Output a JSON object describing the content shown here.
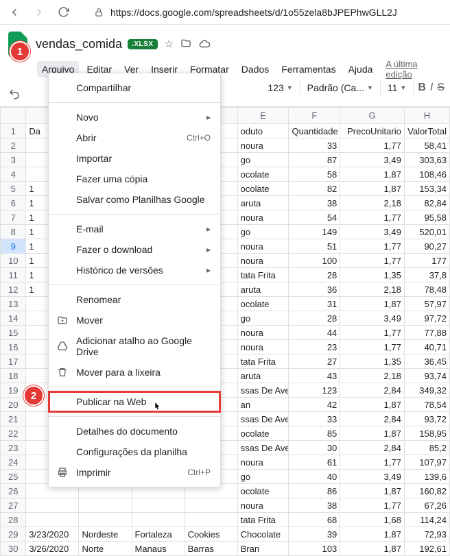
{
  "browser": {
    "url": "https://docs.google.com/spreadsheets/d/1o55zela8bJPEPhwGLL2J"
  },
  "doc": {
    "title": "vendas_comida",
    "badge": ".XLSX"
  },
  "menubar": {
    "items": [
      "Arquivo",
      "Editar",
      "Ver",
      "Inserir",
      "Formatar",
      "Dados",
      "Ferramentas",
      "Ajuda"
    ],
    "last_edit": "A última edição"
  },
  "toolbar": {
    "num_fmt": "123",
    "font": "Padrão (Ca...",
    "font_size": "11",
    "bold": "B",
    "italic": "I",
    "strike": "S"
  },
  "dropdown": {
    "items": [
      {
        "label": "Compartilhar",
        "hasSubmenu": false
      },
      "sep",
      {
        "label": "Novo",
        "hasSubmenu": true
      },
      {
        "label": "Abrir",
        "hasSubmenu": false,
        "shortcut": "Ctrl+O"
      },
      {
        "label": "Importar",
        "hasSubmenu": false
      },
      {
        "label": "Fazer uma cópia",
        "hasSubmenu": false
      },
      {
        "label": "Salvar como Planilhas Google",
        "hasSubmenu": false
      },
      "sep",
      {
        "label": "E-mail",
        "hasSubmenu": true
      },
      {
        "label": "Fazer o download",
        "hasSubmenu": true
      },
      {
        "label": "Histórico de versões",
        "hasSubmenu": true
      },
      "sep",
      {
        "label": "Renomear",
        "hasSubmenu": false
      },
      {
        "label": "Mover",
        "hasSubmenu": false,
        "icon": "folder"
      },
      {
        "label": "Adicionar atalho ao Google Drive",
        "hasSubmenu": false,
        "icon": "drive"
      },
      {
        "label": "Mover para a lixeira",
        "hasSubmenu": false,
        "icon": "trash"
      },
      "sep",
      {
        "label": "Publicar na Web",
        "hasSubmenu": false,
        "highlight": true
      },
      "sep",
      {
        "label": "Detalhes do documento",
        "hasSubmenu": false
      },
      {
        "label": "Configurações da planilha",
        "hasSubmenu": false
      },
      {
        "label": "Imprimir",
        "hasSubmenu": false,
        "shortcut": "Ctrl+P",
        "icon": "print"
      }
    ]
  },
  "columns": [
    "E",
    "F",
    "G",
    "H"
  ],
  "headers": {
    "A": "Da",
    "E": "oduto",
    "F": "Quantidade",
    "G": "PrecoUnitario",
    "H": "ValorTotal"
  },
  "rows": [
    {
      "n": 2,
      "A": "",
      "E": "noura",
      "F": "33",
      "G": "1,77",
      "H": "58,41"
    },
    {
      "n": 3,
      "A": "",
      "E": "go",
      "F": "87",
      "G": "3,49",
      "H": "303,63"
    },
    {
      "n": 4,
      "A": "",
      "E": "ocolate",
      "F": "58",
      "G": "1,87",
      "H": "108,46"
    },
    {
      "n": 5,
      "A": "1",
      "E": "ocolate",
      "F": "82",
      "G": "1,87",
      "H": "153,34"
    },
    {
      "n": 6,
      "A": "1",
      "E": "aruta",
      "F": "38",
      "G": "2,18",
      "H": "82,84"
    },
    {
      "n": 7,
      "A": "1",
      "E": "noura",
      "F": "54",
      "G": "1,77",
      "H": "95,58"
    },
    {
      "n": 8,
      "A": "1",
      "E": "go",
      "F": "149",
      "G": "3,49",
      "H": "520,01"
    },
    {
      "n": 9,
      "A": "1",
      "E": "noura",
      "F": "51",
      "G": "1,77",
      "H": "90,27",
      "sel": true
    },
    {
      "n": 10,
      "A": "1",
      "E": "noura",
      "F": "100",
      "G": "1,77",
      "H": "177"
    },
    {
      "n": 11,
      "A": "1",
      "E": "tata Frita",
      "F": "28",
      "G": "1,35",
      "H": "37,8"
    },
    {
      "n": 12,
      "A": "1",
      "E": "aruta",
      "F": "36",
      "G": "2,18",
      "H": "78,48"
    },
    {
      "n": 13,
      "A": "",
      "E": "ocolate",
      "F": "31",
      "G": "1,87",
      "H": "57,97"
    },
    {
      "n": 14,
      "A": "",
      "E": "go",
      "F": "28",
      "G": "3,49",
      "H": "97,72"
    },
    {
      "n": 15,
      "A": "",
      "E": "noura",
      "F": "44",
      "G": "1,77",
      "H": "77,88"
    },
    {
      "n": 16,
      "A": "",
      "E": "noura",
      "F": "23",
      "G": "1,77",
      "H": "40,71"
    },
    {
      "n": 17,
      "A": "",
      "E": "tata Frita",
      "F": "27",
      "G": "1,35",
      "H": "36,45"
    },
    {
      "n": 18,
      "A": "",
      "E": "aruta",
      "F": "43",
      "G": "2,18",
      "H": "93,74"
    },
    {
      "n": 19,
      "A": "",
      "E": "ssas De Aveia",
      "F": "123",
      "G": "2,84",
      "H": "349,32"
    },
    {
      "n": 20,
      "A": "",
      "E": "an",
      "F": "42",
      "G": "1,87",
      "H": "78,54"
    },
    {
      "n": 21,
      "A": "",
      "E": "ssas De Aveia",
      "F": "33",
      "G": "2,84",
      "H": "93,72"
    },
    {
      "n": 22,
      "A": "",
      "E": "ocolate",
      "F": "85",
      "G": "1,87",
      "H": "158,95"
    },
    {
      "n": 23,
      "A": "",
      "E": "ssas De Aveia",
      "F": "30",
      "G": "2,84",
      "H": "85,2"
    },
    {
      "n": 24,
      "A": "",
      "E": "noura",
      "F": "61",
      "G": "1,77",
      "H": "107,97"
    },
    {
      "n": 25,
      "A": "",
      "E": "go",
      "F": "40",
      "G": "3,49",
      "H": "139,6"
    },
    {
      "n": 26,
      "A": "",
      "E": "ocolate",
      "F": "86",
      "G": "1,87",
      "H": "160,82"
    },
    {
      "n": 27,
      "A": "",
      "E": "noura",
      "F": "38",
      "G": "1,77",
      "H": "67,26"
    },
    {
      "n": 28,
      "A": "",
      "E": "tata Frita",
      "F": "68",
      "G": "1,68",
      "H": "114,24"
    }
  ],
  "bottom_rows": [
    {
      "n": 29,
      "A": "3/23/2020",
      "B": "Nordeste",
      "C": "Fortaleza",
      "D": "Cookies",
      "E": "Chocolate",
      "F": "39",
      "G": "1,87",
      "H": "72,93"
    },
    {
      "n": 30,
      "A": "3/26/2020",
      "B": "Norte",
      "C": "Manaus",
      "D": "Barras",
      "E": "Bran",
      "F": "103",
      "G": "1,87",
      "H": "192,61"
    }
  ],
  "callouts": {
    "step1": "1",
    "step2": "2"
  }
}
